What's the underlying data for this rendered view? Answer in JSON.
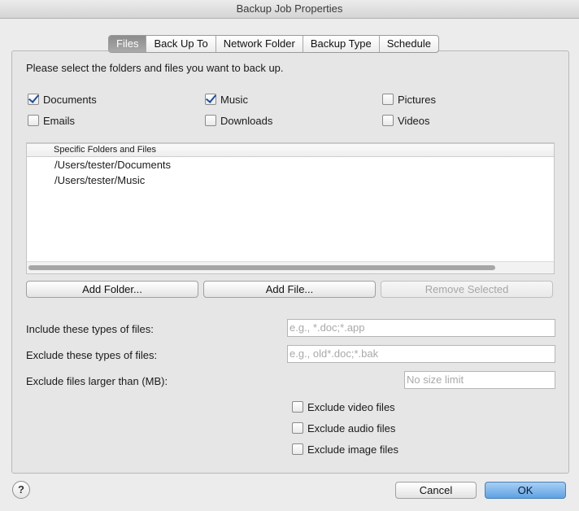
{
  "window": {
    "title": "Backup Job Properties"
  },
  "tabs": [
    "Files",
    "Back Up To",
    "Network Folder",
    "Backup Type",
    "Schedule"
  ],
  "files": {
    "instruction": "Please select the folders and files you want to back up.",
    "checkboxes": {
      "documents": {
        "label": "Documents",
        "checked": true
      },
      "music": {
        "label": "Music",
        "checked": true
      },
      "pictures": {
        "label": "Pictures",
        "checked": false
      },
      "emails": {
        "label": "Emails",
        "checked": false
      },
      "downloads": {
        "label": "Downloads",
        "checked": false
      },
      "videos": {
        "label": "Videos",
        "checked": false
      }
    },
    "list": {
      "header": "Specific Folders and Files",
      "rows": [
        "/Users/tester/Documents",
        "/Users/tester/Music"
      ]
    },
    "buttons": {
      "add_folder": "Add Folder...",
      "add_file": "Add File...",
      "remove_selected": "Remove Selected"
    },
    "filters": {
      "include_label": "Include these types of files:",
      "include_placeholder": "e.g., *.doc;*.app",
      "exclude_label": "Exclude these types of files:",
      "exclude_placeholder": "e.g., old*.doc;*.bak",
      "size_label": "Exclude files larger than (MB):",
      "size_placeholder": "No size limit"
    },
    "exclude_checkboxes": {
      "video": {
        "label": "Exclude video files",
        "checked": false
      },
      "audio": {
        "label": "Exclude audio files",
        "checked": false
      },
      "image": {
        "label": "Exclude image files",
        "checked": false
      }
    }
  },
  "footer": {
    "help": "?",
    "cancel": "Cancel",
    "ok": "OK"
  }
}
